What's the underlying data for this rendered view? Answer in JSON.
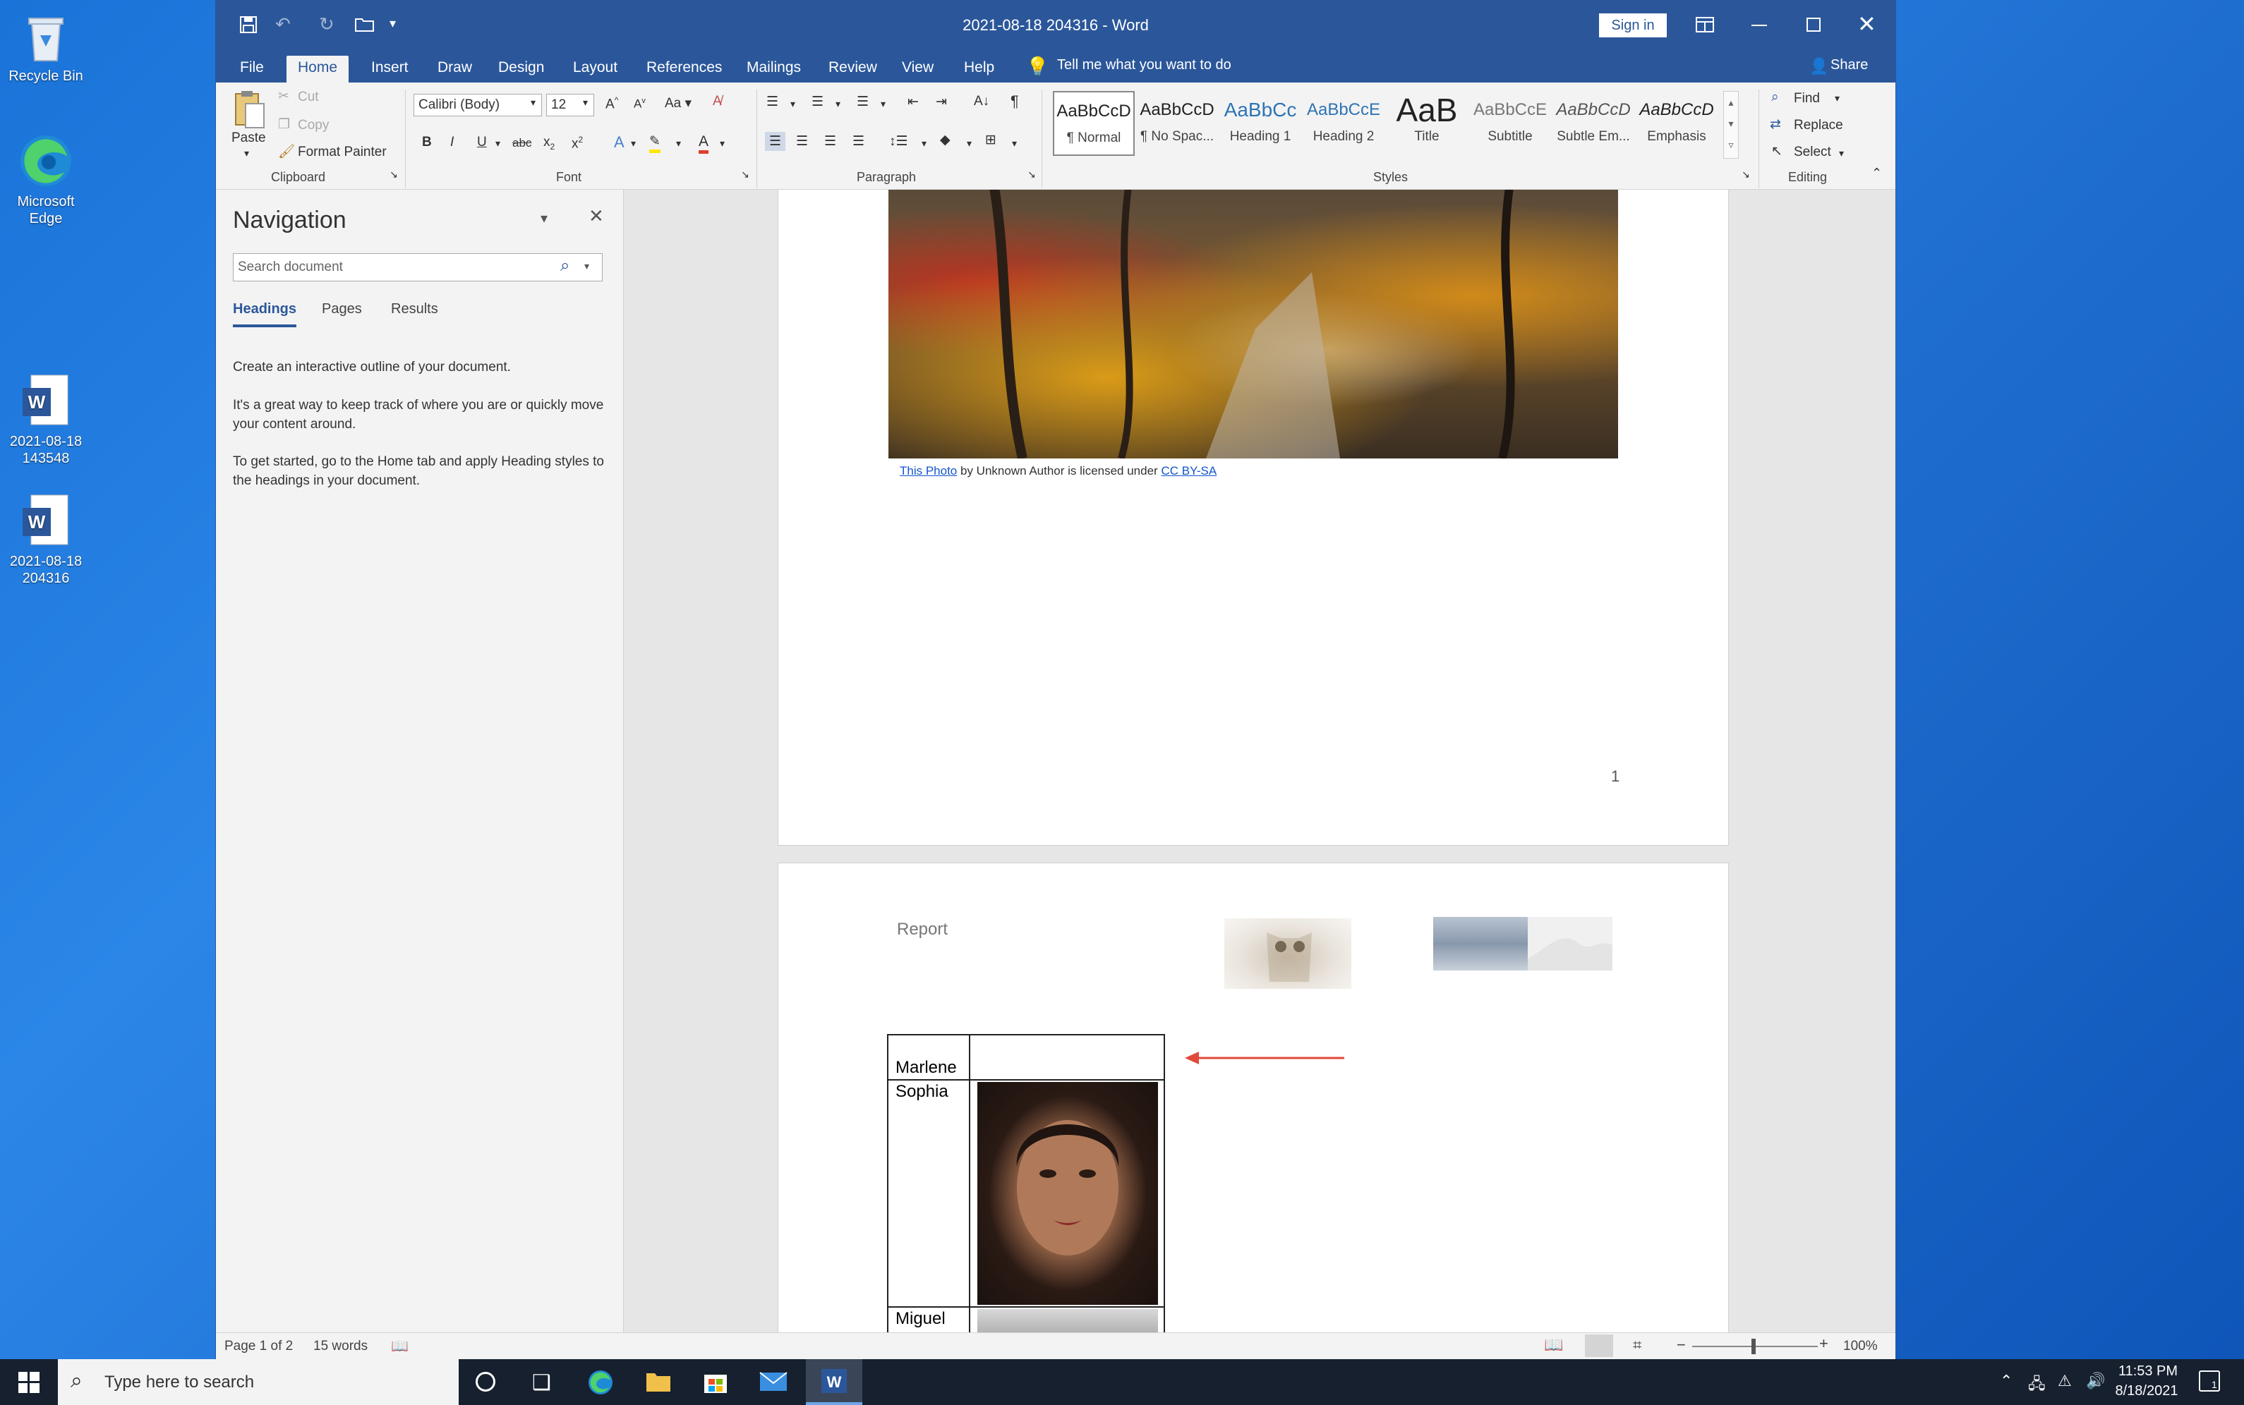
{
  "desktop": {
    "icons": [
      {
        "label": "Recycle Bin"
      },
      {
        "label": "Microsoft Edge"
      },
      {
        "label": "2021-08-18 143548"
      },
      {
        "label": "2021-08-18 204316"
      }
    ]
  },
  "window": {
    "title": "2021-08-18 204316  -  Word",
    "sign_in": "Sign in",
    "share": "Share"
  },
  "ribbon": {
    "tabs": [
      "File",
      "Home",
      "Insert",
      "Draw",
      "Design",
      "Layout",
      "References",
      "Mailings",
      "Review",
      "View",
      "Help"
    ],
    "tell_me": "Tell me what you want to do",
    "clipboard": {
      "paste": "Paste",
      "cut": "Cut",
      "copy": "Copy",
      "format_painter": "Format Painter",
      "label": "Clipboard"
    },
    "font": {
      "name": "Calibri (Body)",
      "size": "12",
      "label": "Font"
    },
    "paragraph": {
      "label": "Paragraph"
    },
    "styles": {
      "label": "Styles",
      "items": [
        {
          "sample": "AaBbCcD",
          "name": "¶ Normal"
        },
        {
          "sample": "AaBbCcD",
          "name": "¶ No Spac..."
        },
        {
          "sample": "AaBbCc",
          "name": "Heading 1"
        },
        {
          "sample": "AaBbCcE",
          "name": "Heading 2"
        },
        {
          "sample": "AaB",
          "name": "Title"
        },
        {
          "sample": "AaBbCcE",
          "name": "Subtitle"
        },
        {
          "sample": "AaBbCcD",
          "name": "Subtle Em..."
        },
        {
          "sample": "AaBbCcD",
          "name": "Emphasis"
        }
      ]
    },
    "editing": {
      "find": "Find",
      "replace": "Replace",
      "select": "Select",
      "label": "Editing"
    }
  },
  "navigation": {
    "title": "Navigation",
    "search_placeholder": "Search document",
    "tabs": [
      "Headings",
      "Pages",
      "Results"
    ],
    "text1": "Create an interactive outline of your document.",
    "text2": "It's a great way to keep track of where you are or quickly move your content around.",
    "text3": "To get started, go to the Home tab and apply Heading styles to the headings in your document."
  },
  "document": {
    "caption_link": "This Photo",
    "caption_mid": " by Unknown Author is licensed under ",
    "caption_license": "CC BY-SA",
    "page_number": "1",
    "header_text": "Report",
    "table_names": [
      "Marlene",
      "Sophia",
      "Miguel"
    ]
  },
  "status": {
    "page": "Page 1 of 2",
    "words": "15 words",
    "zoom": "100%"
  },
  "taskbar": {
    "search_placeholder": "Type here to search",
    "time": "11:53 PM",
    "date": "8/18/2021",
    "notifications": "1"
  },
  "colors": {
    "word_blue": "#2b579a",
    "desktop_blue": "#1f6fd0",
    "taskbar": "#16202e",
    "arrow_red": "#e04a3a"
  }
}
